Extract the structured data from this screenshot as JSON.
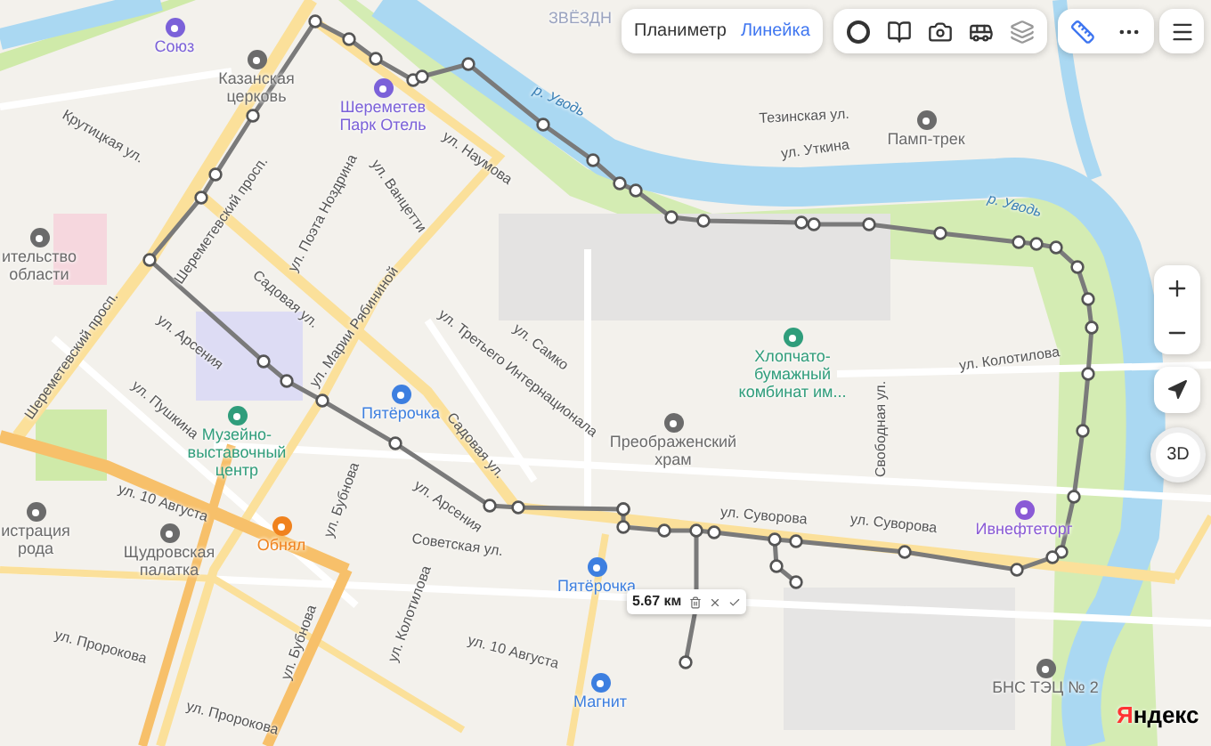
{
  "toolbar": {
    "modes": [
      {
        "label": "Планиметр",
        "selected": false
      },
      {
        "label": "Линейка",
        "selected": true
      }
    ],
    "ruler": {
      "on": true
    }
  },
  "map_labels": [
    {
      "kind": "district",
      "text": "ЗВЁЗДН"
    },
    {
      "kind": "poi",
      "text": "Союз",
      "color": "#7b61d9"
    },
    {
      "kind": "poi",
      "text": "Казанская церковь",
      "color": "#6b6b6b"
    },
    {
      "kind": "poi",
      "text": "Шереметев Парк Отель",
      "color": "#7b61d9"
    },
    {
      "kind": "street",
      "text": "Крутицкая ул."
    },
    {
      "kind": "street",
      "text": "ул. Наумова"
    },
    {
      "kind": "water",
      "text": "р. Уводь"
    },
    {
      "kind": "street",
      "text": "ул. Ванцетти"
    },
    {
      "kind": "street",
      "text": "ул. Поэта Ноздрина"
    },
    {
      "kind": "street",
      "text": "Шереметевский просп."
    },
    {
      "kind": "poi",
      "text": "ительство области",
      "color": "#6b6b6b"
    },
    {
      "kind": "street",
      "text": "Садовая ул."
    },
    {
      "kind": "street",
      "text": "ул. Марии Рябининой"
    },
    {
      "kind": "street",
      "text": "ул. Третьего Интернационала"
    },
    {
      "kind": "street",
      "text": "ул. Самко"
    },
    {
      "kind": "street",
      "text": "ул. Арсения"
    },
    {
      "kind": "street",
      "text": "Шереметевский просп."
    },
    {
      "kind": "street",
      "text": "ул. Пушкина"
    },
    {
      "kind": "poi",
      "text": "Пятёрочка",
      "color": "#3d7fe0"
    },
    {
      "kind": "poi",
      "text": "Музейно-выставочный центр",
      "color": "#2f9d7b"
    },
    {
      "kind": "street",
      "text": "Садовая ул."
    },
    {
      "kind": "poi",
      "text": "Преображенский храм",
      "color": "#6b6b6b"
    },
    {
      "kind": "poi",
      "text": "Хлопчато-бумажный комбинат им...",
      "color": "#2f9d7b"
    },
    {
      "kind": "street",
      "text": "ул. Колотилова"
    },
    {
      "kind": "street",
      "text": "ул. Арсения"
    },
    {
      "kind": "street",
      "text": "ул. 10 Августа"
    },
    {
      "kind": "poi",
      "text": "Обнял",
      "color": "#f0821e"
    },
    {
      "kind": "poi",
      "text": "истрация рода",
      "color": "#6b6b6b"
    },
    {
      "kind": "poi",
      "text": "Щудровская палатка",
      "color": "#6b6b6b"
    },
    {
      "kind": "street",
      "text": "ул. Бубнова"
    },
    {
      "kind": "street",
      "text": "Советская ул."
    },
    {
      "kind": "street",
      "text": "Свободная ул."
    },
    {
      "kind": "street",
      "text": "ул. Суворова"
    },
    {
      "kind": "street",
      "text": "ул. Суворова"
    },
    {
      "kind": "poi",
      "text": "Ивнефтеторг",
      "color": "#8a5ad6"
    },
    {
      "kind": "poi",
      "text": "Пятёрочка",
      "color": "#3d7fe0"
    },
    {
      "kind": "street",
      "text": "ул. 10 Августа"
    },
    {
      "kind": "street",
      "text": "ул. Пророкова"
    },
    {
      "kind": "street",
      "text": "ул. Пророкова"
    },
    {
      "kind": "street",
      "text": "ул. Бубнова"
    },
    {
      "kind": "street",
      "text": "ул. Колотилова"
    },
    {
      "kind": "poi",
      "text": "Магнит",
      "color": "#3d7fe0"
    },
    {
      "kind": "poi",
      "text": "БНС ТЭЦ № 2",
      "color": "#6b6b6b"
    },
    {
      "kind": "street",
      "text": "Тезинская ул."
    },
    {
      "kind": "street",
      "text": "ул. Уткина"
    },
    {
      "kind": "poi",
      "text": "Памп-трек",
      "color": "#6b6b6b"
    },
    {
      "kind": "water",
      "text": "р. Уводь"
    }
  ],
  "measurement": {
    "distance": "5.67 км"
  },
  "controls": {
    "view_mode": "3D"
  },
  "logo": "Яндекс"
}
